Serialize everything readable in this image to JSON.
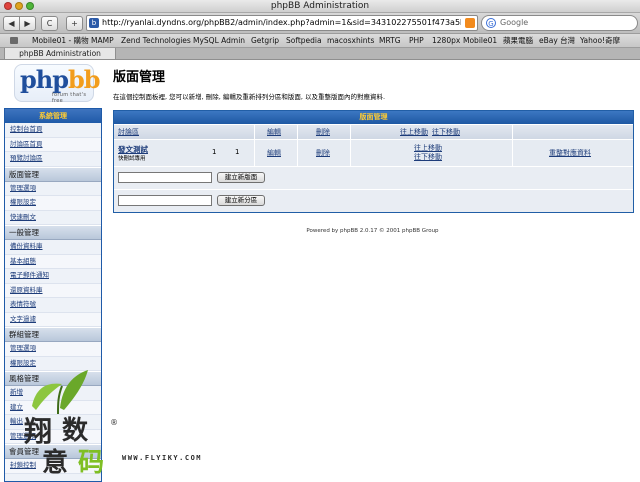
{
  "window": {
    "title": "phpBB Administration"
  },
  "toolbar": {
    "back_glyph": "◀",
    "forward_glyph": "▶",
    "refresh_glyph": "C",
    "add_glyph": "+",
    "url": "http://ryanlai.dyndns.org/phpBB2/admin/index.php?admin=1&sid=343102275501f473a5b31c89",
    "search_placeholder": "Google",
    "search_icon_glyph": "G"
  },
  "bookmarks": [
    "Mobile01 - 購物",
    "MAMP",
    "Zend Technologies",
    "MySQL Admin",
    "Getgrip",
    "Softpedia",
    "macosxhints",
    "MRTG",
    "PHP",
    "1280px",
    "Mobile01",
    "蘋果電腦",
    "eBay 台灣",
    "Yahoo!奇摩"
  ],
  "tab": {
    "label": "phpBB Administration"
  },
  "logo": {
    "php": "php",
    "bb": "bb",
    "tagline": "forum that's free"
  },
  "page": {
    "title": "版面管理",
    "description": "在這個控制面板裡, 您可以新增, 刪除, 編輯及重新排列分區和版面, 以及重整版面內的對應資料."
  },
  "sidebar": {
    "header": "系統管理",
    "sections": [
      {
        "items": [
          "控制台首頁",
          "討論區首頁",
          "預覽討論區"
        ]
      },
      {
        "category": "版面管理",
        "items": [
          "管理選項",
          "權限設定",
          "快速刪文"
        ]
      },
      {
        "category": "一般管理",
        "items": [
          "備份資料庫",
          "基本組態",
          "電子郵件通知",
          "還原資料庫",
          "表情符號",
          "文字過濾"
        ]
      },
      {
        "category": "群組管理",
        "items": [
          "管理選項",
          "權限設定"
        ]
      },
      {
        "category": "風格管理",
        "items": [
          "新增",
          "建立",
          "輸出",
          "管理選項"
        ]
      },
      {
        "category": "會員管理",
        "items": [
          "封鎖控制"
        ]
      }
    ]
  },
  "table": {
    "title": "版面管理",
    "header": {
      "forum": "討論區",
      "edit": "編輯",
      "delete": "刪除",
      "move_up": "往上移動",
      "move_down": "往下移動"
    },
    "forum_row": {
      "name": "發文測試",
      "description": "快刪試專用",
      "topics": "1",
      "posts": "1",
      "edit": "編輯",
      "delete": "刪除",
      "move_up": "往上移動",
      "move_down": "往下移動",
      "resync": "重整對應資料"
    },
    "add_forum_button": "建立新版面",
    "add_category_button": "建立新分區"
  },
  "footer": {
    "text": "Powered by phpBB 2.0.17 © 2001 phpBB Group"
  },
  "watermark": {
    "chars": [
      "翔",
      "数",
      "意",
      "码"
    ],
    "reg": "®",
    "site": "WWW.FLYIKY.COM"
  }
}
